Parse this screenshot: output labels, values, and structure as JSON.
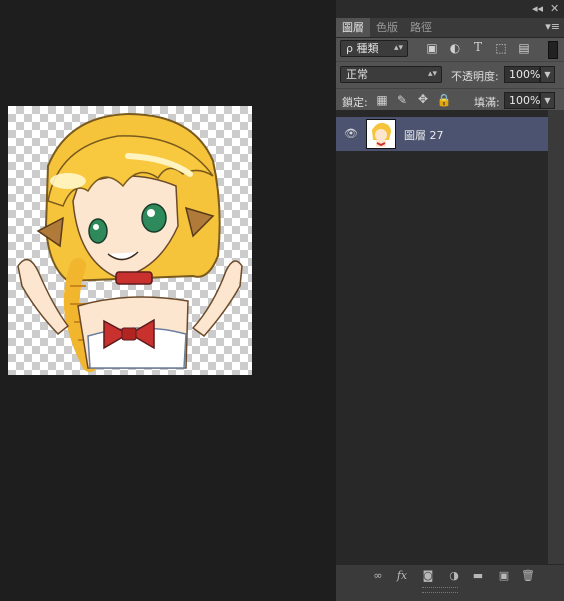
{
  "panel": {
    "controls": {
      "collapse": "◂◂",
      "close": "✕"
    },
    "tabs": [
      {
        "label": "圖層",
        "active": true
      },
      {
        "label": "色版",
        "active": false
      },
      {
        "label": "路徑",
        "active": false
      }
    ],
    "menu_icon": "panel-menu-icon",
    "filter": {
      "search_symbol": "ρ",
      "kind_label": "種類",
      "filter_icons": [
        "image-filter-icon",
        "adjustment-filter-icon",
        "type-filter-icon",
        "shape-filter-icon",
        "smart-object-filter-icon"
      ],
      "toggle_icon": "filter-toggle-icon"
    },
    "blend": {
      "mode": "正常",
      "opacity_label": "不透明度:",
      "opacity_value": "100%"
    },
    "lock": {
      "label": "鎖定:",
      "icons": [
        "lock-transparent-icon",
        "lock-paint-icon",
        "lock-move-icon",
        "lock-all-icon"
      ],
      "fill_label": "填滿:",
      "fill_value": "100%"
    },
    "layers": [
      {
        "name": "圖層 27",
        "visible": true,
        "selected": true
      }
    ],
    "footer_icons": [
      "link-icon",
      "fx-icon",
      "mask-icon",
      "adjustment-icon",
      "group-folder-icon",
      "new-layer-icon",
      "trash-icon"
    ],
    "footer_fx": "fx",
    "colors": {
      "selected_layer": "#4b5370",
      "panel_bg": "#535353",
      "list_bg": "#282828"
    }
  }
}
